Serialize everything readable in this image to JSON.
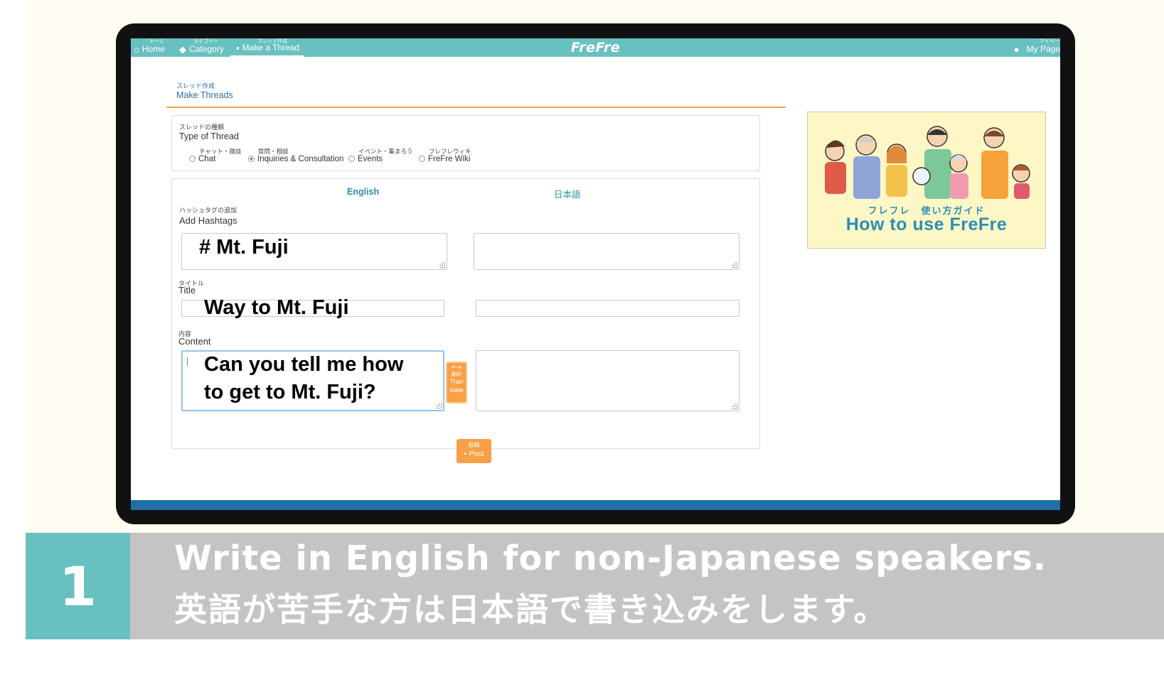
{
  "nav": {
    "home": {
      "jp": "ホーム",
      "label": "Home"
    },
    "category": {
      "jp": "カテゴリー",
      "label": "Category"
    },
    "make_thread": {
      "jp": "スレッド作成",
      "label": "Make a Thread"
    },
    "logo": "FreFre",
    "my_page": {
      "jp": "マイページ",
      "label": "My Page"
    }
  },
  "page": {
    "heading_jp": "スレッド作成",
    "heading_en": "Make Threads"
  },
  "thread_type": {
    "label_jp": "スレッドの種類",
    "label_en": "Type of Thread",
    "options": [
      {
        "jp": "チャット・雑談",
        "label": "Chat",
        "selected": false
      },
      {
        "jp": "質問・相談",
        "label": "Inquiries & Consultation",
        "selected": true
      },
      {
        "jp": "イベント・集まろう",
        "label": "Events",
        "selected": false
      },
      {
        "jp": "フレフレウィキ",
        "label": "FreFre Wiki",
        "selected": false
      }
    ]
  },
  "form": {
    "tab_english": "English",
    "tab_japanese": "日本語",
    "hashtags_jp": "ハッシュタグの追加",
    "hashtags_en": "Add Hashtags",
    "hashtags_value": "# Mt. Fuji",
    "title_jp": "タイトル",
    "title_en": "Title",
    "title_value": "Way to Mt. Fuji",
    "content_jp": "内容",
    "content_en": "Content",
    "content_value_line1": "Can you tell me how",
    "content_value_line2": "to get to Mt. Fuji?",
    "translate_jp": "翻訳",
    "translate_label_1": "Tran",
    "translate_label_2": "slate",
    "post_jp": "投稿",
    "post_label": "Post"
  },
  "ad": {
    "jp": "フレフレ　使い方ガイド",
    "en": "How to use  FreFre"
  },
  "caption": {
    "number": "1",
    "line1": "Write in English for non-Japanese speakers.",
    "line2": "英語が苦手な方は日本語で書き込みをします。"
  },
  "colors": {
    "nav": "#68c1c0",
    "accent_orange": "#f7a046",
    "link_blue": "#2a6fa8",
    "caption_gray": "#c4c4c4"
  }
}
